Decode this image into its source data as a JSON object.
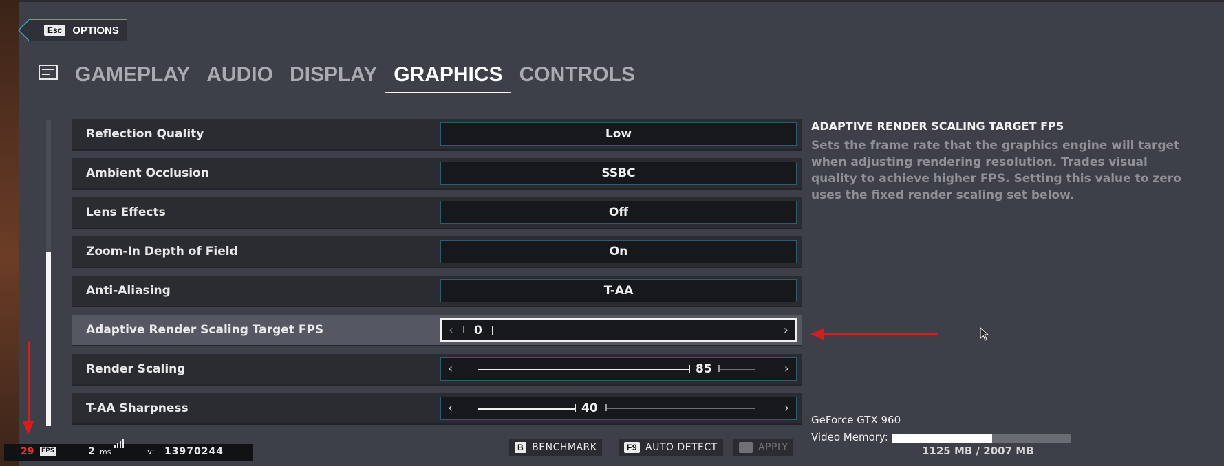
{
  "header": {
    "back_key": "Esc",
    "back_label": "OPTIONS",
    "tabs": [
      {
        "label": "GAMEPLAY"
      },
      {
        "label": "AUDIO"
      },
      {
        "label": "DISPLAY"
      },
      {
        "label": "GRAPHICS"
      },
      {
        "label": "CONTROLS"
      }
    ],
    "active_tab": "GRAPHICS"
  },
  "settings": {
    "rows": [
      {
        "label": "Reflection Quality",
        "value": "Low"
      },
      {
        "label": "Ambient Occlusion",
        "value": "SSBC"
      },
      {
        "label": "Lens Effects",
        "value": "Off"
      },
      {
        "label": "Zoom-In Depth of Field",
        "value": "On"
      },
      {
        "label": "Anti-Aliasing",
        "value": "T-AA"
      },
      {
        "label": "Adaptive Render Scaling Target FPS",
        "value": "0"
      },
      {
        "label": "Render Scaling",
        "value": "85"
      },
      {
        "label": "T-AA Sharpness",
        "value": "40"
      }
    ]
  },
  "description": {
    "title": "ADAPTIVE RENDER SCALING TARGET FPS",
    "body": "Sets the frame rate that the graphics engine will target when adjusting rendering resolution. Trades visual quality to achieve higher FPS. Setting this value to zero uses the fixed render scaling set below."
  },
  "gpu": {
    "name": "GeForce GTX 960",
    "memory_label": "Video Memory:",
    "memory_text": "1125 MB / 2007 MB",
    "memory_fraction": 0.56
  },
  "actions": {
    "benchmark_key": "B",
    "benchmark_label": "BENCHMARK",
    "autodetect_key": "F9",
    "autodetect_label": "AUTO DETECT",
    "apply_label": "APPLY"
  },
  "perf": {
    "fps": "29",
    "fps_unit": "FPS",
    "ms": "2",
    "ms_unit": "ms",
    "version_label": "v:",
    "version": "13970244"
  },
  "colors": {
    "accent_border": "#47a7c2",
    "annotation_red": "#e01818",
    "fps_red": "#ff2a2a"
  }
}
